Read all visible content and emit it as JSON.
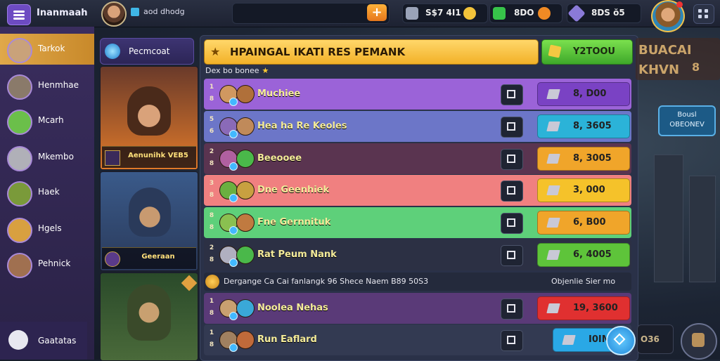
{
  "app": {
    "title": "Inanmaah",
    "breadcrumb": "aod dhodg",
    "search_placeholder": "",
    "add_icon": "plus-icon"
  },
  "resources": [
    {
      "icon": "shield-icon",
      "value": "S$7 4I1",
      "color": "#9aa3b8"
    },
    {
      "icon": "coin-icon",
      "value": "",
      "color": "#f3c33a"
    },
    {
      "icon": "cash-icon",
      "value": "8DO",
      "color": "#37c34a"
    },
    {
      "icon": "potion-icon",
      "value": "",
      "color": "#f08a24"
    },
    {
      "icon": "gem-icon",
      "value": "8DS ŏ5",
      "color": "#8a7ad8"
    }
  ],
  "sidebar": {
    "items": [
      {
        "label": "Tarkok",
        "active": true,
        "color": "#c9a27a"
      },
      {
        "label": "Henmhae",
        "active": false,
        "color": "#8a7a6a"
      },
      {
        "label": "Mcarh",
        "active": false,
        "color": "#6bbf4a"
      },
      {
        "label": "Mkembo",
        "active": false,
        "color": "#b0b0b8"
      },
      {
        "label": "Haek",
        "active": false,
        "color": "#7a9a3a"
      },
      {
        "label": "Hgels",
        "active": false,
        "color": "#d8a040"
      },
      {
        "label": "Pehnick",
        "active": false,
        "color": "#a07050"
      }
    ],
    "bottom_label": "Gaatatas"
  },
  "heroes": {
    "header_label": "Pecmcoat",
    "cards": [
      {
        "name": "Aenunihk VEB5",
        "top_color": "#6a3a2a",
        "bottom_color": "#e07a2a"
      },
      {
        "name": "Geeraan",
        "top_color": "#3a5a8a",
        "bottom_color": "#2a3a5a"
      },
      {
        "name": "",
        "top_color": "#2a4a2a",
        "bottom_color": "#4a6a3a"
      }
    ]
  },
  "panel": {
    "title": "HPAINGAL IKATI RES PEMANK",
    "claim_label": "Y2TOOU",
    "subtitle": "Dex bo bonee",
    "section_left": "Dergange Ca Cai fanlangk  96 Shece Naem B89 50S3",
    "section_right": "Objenlie Sier mo"
  },
  "rows": [
    {
      "rank": "1 8",
      "name": "Muchiee",
      "price": "8, D00",
      "row_color": "#9b63d8",
      "btn_color": "#7a42c4",
      "av1": "#d09860",
      "av2": "#b0703a"
    },
    {
      "rank": "5 6",
      "name": "Hea ha Re Keoles",
      "price": "8, 3605",
      "row_color": "#6c76c8",
      "btn_color": "#2bb3d8",
      "av1": "#8a6ab8",
      "av2": "#c08a5a"
    },
    {
      "rank": "2 8",
      "name": "Beeooee",
      "price": "8, 3005",
      "row_color": "#5a3450",
      "btn_color": "#f0a52a",
      "av1": "#b060a0",
      "av2": "#4ab84a"
    },
    {
      "rank": "3 8",
      "name": "Dne Geenhiek",
      "price": "3, 000",
      "row_color": "#f08080",
      "btn_color": "#f5c22a",
      "av1": "#6ab040",
      "av2": "#c8a040"
    },
    {
      "rank": "8 8",
      "name": "Fne Gernnituk",
      "price": "6, B00",
      "row_color": "#5ed07a",
      "btn_color": "#f0a52a",
      "av1": "#8ac050",
      "av2": "#c07a40"
    },
    {
      "rank": "2 8",
      "name": "Rat Peum Nank",
      "price": "6, 4005",
      "row_color": "#2c3044",
      "btn_color": "#5ec43a",
      "av1": "#b0b0c0",
      "av2": "#4ab84a"
    },
    {
      "rank": "1 8",
      "name": "Noolea Nehas",
      "price": "19, 3600",
      "row_color": "#5a3a78",
      "btn_color": "#e03030",
      "av1": "#c8a070",
      "av2": "#3aa8d8"
    },
    {
      "rank": "1 8",
      "name": "Run Eaflard",
      "price": "I0IM",
      "row_color": "#333a52",
      "btn_color": "#2aa8e6",
      "av1": "#a08060",
      "av2": "#c06a3a"
    }
  ],
  "right": {
    "sign": "BUACAI KHVN",
    "sign_suffix": "8",
    "button_label": "Bousl OBEONEV",
    "bottom_label": "O36"
  }
}
